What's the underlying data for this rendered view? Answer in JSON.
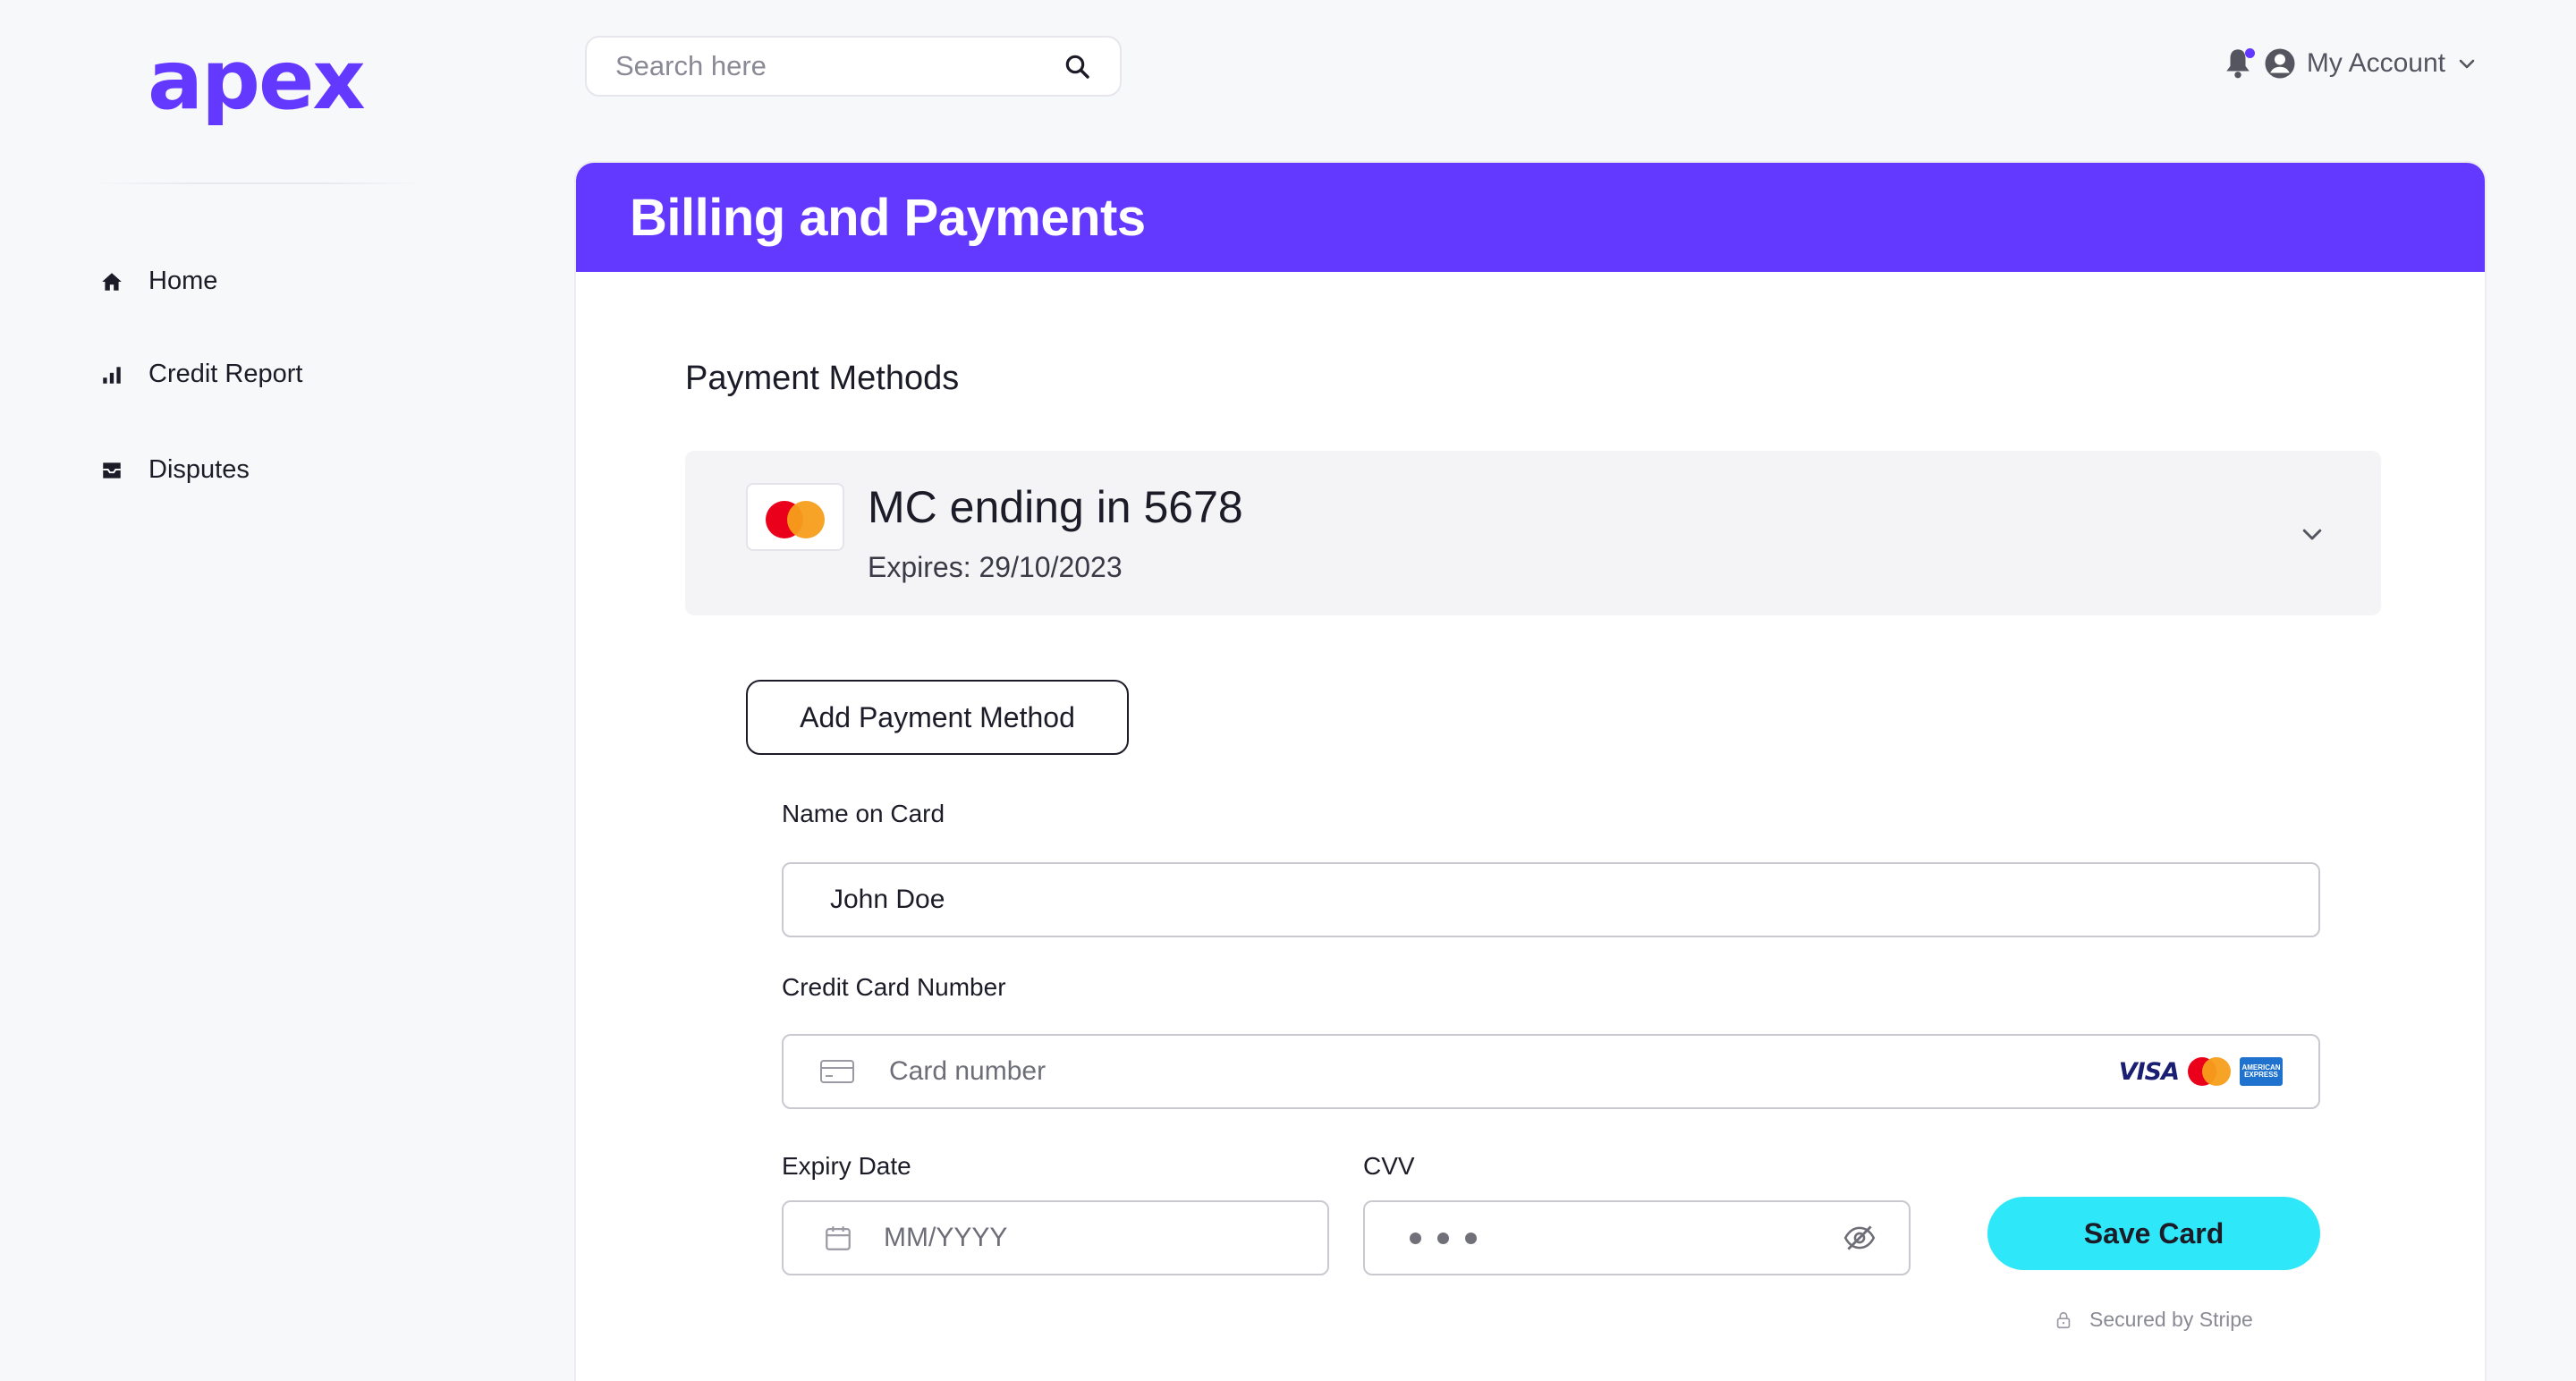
{
  "brand": {
    "logo_text": "apex",
    "color": "#6439ff"
  },
  "sidebar": {
    "items": [
      {
        "label": "Home",
        "icon": "home-icon"
      },
      {
        "label": "Credit Report",
        "icon": "bar-chart-icon"
      },
      {
        "label": "Disputes",
        "icon": "inbox-icon"
      }
    ]
  },
  "header": {
    "search_placeholder": "Search here",
    "account_label": "My Account"
  },
  "page": {
    "title": "Billing and Payments",
    "section_title": "Payment Methods"
  },
  "payment_method": {
    "title": "MC ending in 5678",
    "expires": "Expires: 29/10/2023"
  },
  "form": {
    "add_button": "Add Payment Method",
    "name_label": "Name on Card",
    "name_value": "John Doe",
    "card_label": "Credit Card Number",
    "card_placeholder": "Card number",
    "card_brands": {
      "visa": "VISA",
      "amex": "AMERICAN EXPRESS"
    },
    "expiry_label": "Expiry Date",
    "expiry_placeholder": "MM/YYYY",
    "cvv_label": "CVV",
    "save_button": "Save Card",
    "secured_text": "Secured by Stripe"
  },
  "colors": {
    "accent": "#6439ff",
    "save_button": "#2ee8fa",
    "background": "#f7f8fa"
  }
}
